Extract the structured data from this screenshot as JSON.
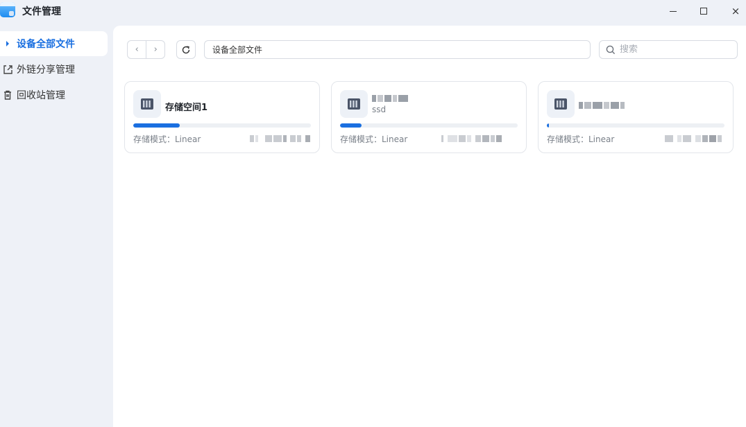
{
  "app": {
    "title": "文件管理"
  },
  "window_controls": {
    "minimize": "minimize-icon",
    "maximize": "maximize-icon",
    "close": "×"
  },
  "sidebar": {
    "items": [
      {
        "label": "设备全部文件",
        "icon": "caret-right-icon",
        "active": true
      },
      {
        "label": "外链分享管理",
        "icon": "share-out-icon",
        "active": false
      },
      {
        "label": "回收站管理",
        "icon": "trash-icon",
        "active": false
      }
    ]
  },
  "toolbar": {
    "back_glyph": "‹",
    "forward_glyph": "›",
    "refresh_icon": "refresh-icon",
    "path": "设备全部文件",
    "search_placeholder": "搜索"
  },
  "storage": [
    {
      "name": "存储空间1",
      "subtitle": "",
      "mode_label": "存储模式：Linear",
      "usage": 0.26,
      "icon": "server-icon"
    },
    {
      "name": "",
      "subtitle": "ssd",
      "mode_label": "存储模式：Linear",
      "usage": 0.12,
      "icon": "server-icon"
    },
    {
      "name": "",
      "subtitle": "",
      "mode_label": "存储模式：Linear",
      "usage": 0.01,
      "icon": "server-icon"
    }
  ],
  "colors": {
    "accent": "#1a6fe0",
    "sidebar_bg": "#eef1f7",
    "content_bg": "#ffffff"
  }
}
